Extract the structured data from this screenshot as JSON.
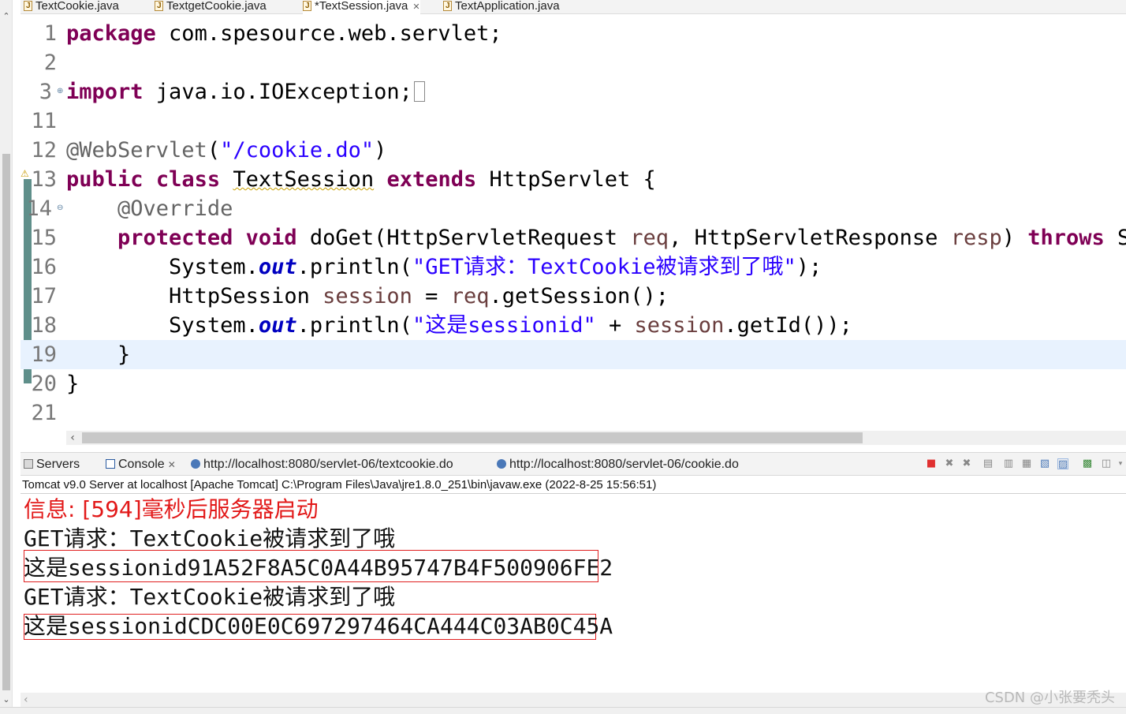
{
  "editor_tabs": [
    {
      "label": "TextCookie.java"
    },
    {
      "label": "TextgetCookie.java"
    },
    {
      "label": "*TextSession.java",
      "active": true
    },
    {
      "label": "TextApplication.java"
    }
  ],
  "editor": {
    "lines": [
      {
        "num": "1"
      },
      {
        "num": "2"
      },
      {
        "num": "3"
      },
      {
        "num": "11"
      },
      {
        "num": "12"
      },
      {
        "num": "13"
      },
      {
        "num": "14"
      },
      {
        "num": "15"
      },
      {
        "num": "16"
      },
      {
        "num": "17"
      },
      {
        "num": "18"
      },
      {
        "num": "19"
      },
      {
        "num": "20"
      },
      {
        "num": "21"
      }
    ],
    "tokens": {
      "package_kw": "package",
      "package_name": " com.spesource.web.servlet;",
      "import_kw": "import",
      "import_name": " java.io.IOException;",
      "annotation": "@WebServlet",
      "annotation_open": "(",
      "annotation_value": "\"/cookie.do\"",
      "annotation_close": ")",
      "public_kw": "public",
      "class_kw": "class",
      "class_name": "TextSession",
      "extends_kw": "extends",
      "super_name": " HttpServlet {",
      "override": "@Override",
      "protected_kw": "protected",
      "void_kw": "void",
      "method_sig_1": " doGet(HttpServletRequest ",
      "param_req": "req",
      "method_sig_2": ", HttpServletResponse ",
      "param_resp": "resp",
      "method_sig_3": ") ",
      "throws_kw": "throws",
      "method_sig_4": " Se",
      "sys1": "System.",
      "out1": "out",
      "println1": ".println(",
      "str1": "\"GET请求：TextCookie被请求到了哦\"",
      "end1": ");",
      "httpsession": "HttpSession ",
      "var_session": "session",
      "assign": " = ",
      "var_req": "req",
      "getsession": ".getSession();",
      "sys2": "System.",
      "out2": "out",
      "println2": ".println(",
      "str2": "\"这是sessionid\"",
      "plus": " + ",
      "var_session2": "session",
      "getid": ".getId());",
      "close_method": "}",
      "close_class": "}"
    }
  },
  "panel_tabs": [
    {
      "label": "Servers",
      "icon": "servers-icon"
    },
    {
      "label": "Console",
      "icon": "console-icon"
    },
    {
      "label": "http://localhost:8080/servlet-06/textcookie.do",
      "icon": "globe-icon"
    },
    {
      "label": "http://localhost:8080/servlet-06/cookie.do",
      "icon": "globe-icon"
    }
  ],
  "console": {
    "header": "Tomcat v9.0 Server at localhost [Apache Tomcat] C:\\Program Files\\Java\\jre1.8.0_251\\bin\\javaw.exe  (2022-8-25 15:56:51)",
    "lines": [
      {
        "text": "信息: [594]毫秒后服务器启动",
        "color": "#e21818"
      },
      {
        "text": "GET请求：TextCookie被请求到了哦",
        "color": "#111111"
      },
      {
        "text": "这是sessionid91A52F8A5C0A44B95747B4F500906FE2",
        "color": "#111111",
        "boxed": true
      },
      {
        "text": "GET请求：TextCookie被请求到了哦",
        "color": "#111111"
      },
      {
        "text": "这是sessionidCDC00E0C697297464CA444C03AB0C45A",
        "color": "#111111",
        "boxed": true
      }
    ]
  },
  "toolbar_icons": [
    "terminate-icon",
    "remove-launch-icon",
    "remove-all-icon",
    "scroll-lock-icon",
    "clear-console-icon",
    "pin-console-icon",
    "word-wrap-icon",
    "show-on-output-icon",
    "open-console-icon",
    "display-selected-console-icon"
  ],
  "watermark": "CSDN @小张要秃头",
  "colors": {
    "keyword": "#7f0055",
    "string": "#2a00ff",
    "annotation": "#646464",
    "static_field": "#0000c0",
    "local_var": "#6a3e3e",
    "current_line": "#e8f2fe",
    "console_error": "#e21818",
    "highlight_box": "#e02020"
  }
}
